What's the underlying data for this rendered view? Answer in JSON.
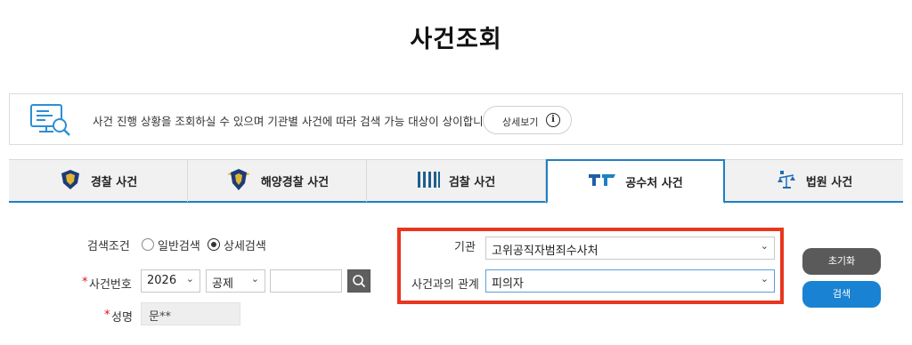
{
  "page": {
    "title": "사건조회"
  },
  "notice": {
    "text": "사건 진행 상황을 조회하실 수 있으며 기관별 사건에 따라 검색 가능 대상이 상이합니다.",
    "detail_button": "상세보기",
    "info_glyph": "i"
  },
  "tabs": [
    {
      "label": "경찰 사건",
      "icon": "police-badge-icon",
      "active": false
    },
    {
      "label": "해양경찰 사건",
      "icon": "coast-guard-badge-icon",
      "active": false
    },
    {
      "label": "검찰 사건",
      "icon": "prosecution-bars-icon",
      "active": false
    },
    {
      "label": "공수처 사건",
      "icon": "cio-logo-icon",
      "active": true
    },
    {
      "label": "법원 사건",
      "icon": "court-scales-icon",
      "active": false
    }
  ],
  "form": {
    "search_condition": {
      "label": "검색조건",
      "options": [
        {
          "label": "일반검색",
          "selected": false
        },
        {
          "label": "상세검색",
          "selected": true
        }
      ]
    },
    "case_number": {
      "required_mark": "*",
      "label": "사건번호",
      "year": "2026",
      "type": "공제",
      "number": ""
    },
    "name": {
      "required_mark": "*",
      "label": "성명",
      "value": "문**"
    },
    "agency": {
      "label": "기관",
      "value": "고위공직자범죄수사처"
    },
    "relation": {
      "label": "사건과의 관계",
      "value": "피의자"
    }
  },
  "buttons": {
    "reset": "초기화",
    "search": "검색"
  },
  "colors": {
    "accent": "#1f7fc4",
    "highlight": "#e8361f",
    "reset_button": "#5a5a5a",
    "search_button": "#1a82d2"
  }
}
